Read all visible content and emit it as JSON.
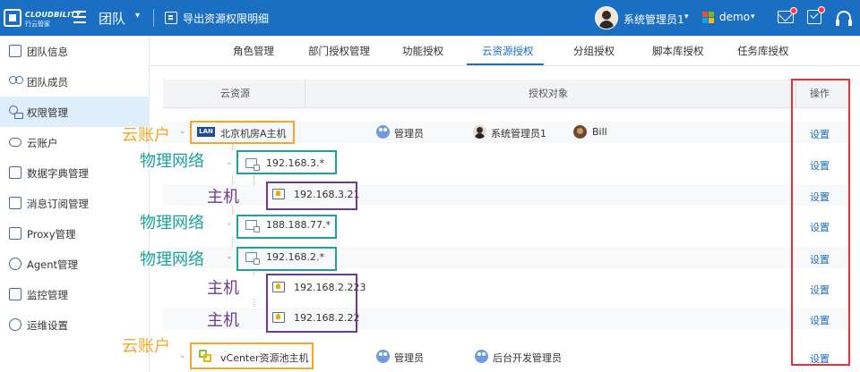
{
  "header": {
    "brand": "CLOUDBILITY",
    "brand_sub": "行云管家",
    "title": "团队",
    "export_label": "导出资源权限明细",
    "user_name": "系统管理员1",
    "tenant": "demo"
  },
  "sidebar": {
    "items": [
      {
        "label": "团队信息"
      },
      {
        "label": "团队成员"
      },
      {
        "label": "权限管理"
      },
      {
        "label": "云账户"
      },
      {
        "label": "数据字典管理"
      },
      {
        "label": "消息订阅管理"
      },
      {
        "label": "Proxy管理"
      },
      {
        "label": "Agent管理"
      },
      {
        "label": "监控管理"
      },
      {
        "label": "运维设置"
      }
    ]
  },
  "tabs": [
    {
      "label": "角色管理"
    },
    {
      "label": "部门授权管理"
    },
    {
      "label": "功能授权"
    },
    {
      "label": "云资源授权"
    },
    {
      "label": "分组授权"
    },
    {
      "label": "脚本库授权"
    },
    {
      "label": "任务库授权"
    }
  ],
  "table": {
    "headers": {
      "resource": "云资源",
      "auth": "授权对象",
      "action": "操作"
    },
    "action_label": "设置",
    "rows": [
      {
        "label": "北京机房A主机",
        "auth": [
          "管理员",
          "系统管理员1",
          "Bill"
        ]
      },
      {
        "label": "192.168.3.*"
      },
      {
        "label": "192.168.3.21"
      },
      {
        "label": "188.188.77.*"
      },
      {
        "label": "192.168.2.*"
      },
      {
        "label": "192.168.2.223"
      },
      {
        "label": "192.168.2.22"
      },
      {
        "label": "vCenter资源池主机",
        "auth": [
          "管理员",
          "后台开发管理员"
        ]
      }
    ],
    "lan_badge": "LAN"
  },
  "annotations": {
    "cloud_account": "云账户",
    "physical_network": "物理网络",
    "host": "主机"
  },
  "colors": {
    "primary": "#1b6fc2",
    "annotation_orange": "#f5a623",
    "annotation_teal": "#1aa39a",
    "annotation_purple": "#6b3a8f",
    "annotation_red": "#e8323a"
  }
}
